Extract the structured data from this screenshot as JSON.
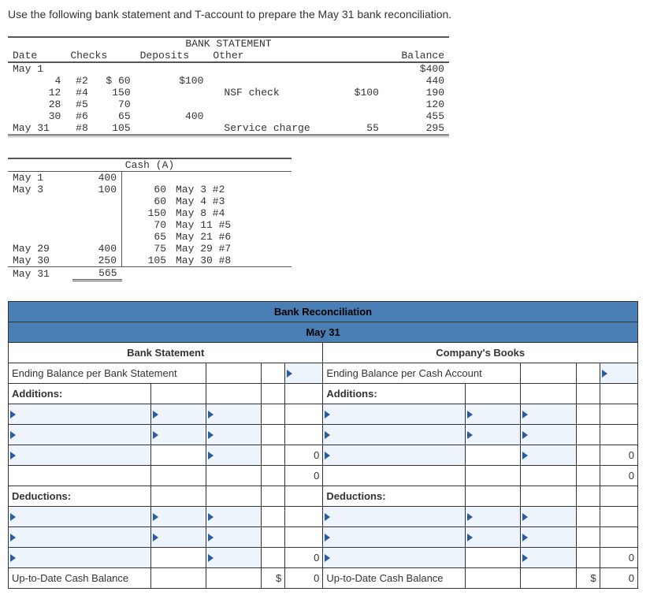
{
  "instruction": "Use the following bank statement and T-account to prepare the May 31 bank reconciliation.",
  "bank_statement": {
    "title": "BANK STATEMENT",
    "headers": {
      "date": "Date",
      "checks": "Checks",
      "deposits": "Deposits",
      "other": "Other",
      "balance": "Balance"
    },
    "rows": [
      {
        "date": "May 1",
        "check_no": "",
        "check_amt": "",
        "deposit": "",
        "other": "",
        "other_amt": "",
        "balance": "$400"
      },
      {
        "date": "4",
        "check_no": "#2",
        "check_amt": "$ 60",
        "deposit": "$100",
        "other": "",
        "other_amt": "",
        "balance": "440"
      },
      {
        "date": "12",
        "check_no": "#4",
        "check_amt": "150",
        "deposit": "",
        "other": "NSF check",
        "other_amt": "$100",
        "balance": "190"
      },
      {
        "date": "28",
        "check_no": "#5",
        "check_amt": "70",
        "deposit": "",
        "other": "",
        "other_amt": "",
        "balance": "120"
      },
      {
        "date": "30",
        "check_no": "#6",
        "check_amt": "65",
        "deposit": "400",
        "other": "",
        "other_amt": "",
        "balance": "455"
      },
      {
        "date": "May 31",
        "check_no": "#8",
        "check_amt": "105",
        "deposit": "",
        "other": "Service charge",
        "other_amt": "55",
        "balance": "295"
      }
    ]
  },
  "t_account": {
    "title": "Cash (A)",
    "debits": [
      {
        "date": "May 1",
        "amt": "400"
      },
      {
        "date": "May 3",
        "amt": "100"
      },
      {
        "date": "",
        "amt": ""
      },
      {
        "date": "",
        "amt": ""
      },
      {
        "date": "",
        "amt": ""
      },
      {
        "date": "",
        "amt": ""
      },
      {
        "date": "May 29",
        "amt": "400"
      },
      {
        "date": "May 30",
        "amt": "250"
      }
    ],
    "credits": [
      {
        "amt": "",
        "desc": ""
      },
      {
        "amt": "60",
        "desc": "May 3 #2"
      },
      {
        "amt": "60",
        "desc": "May 4 #3"
      },
      {
        "amt": "150",
        "desc": "May 8 #4"
      },
      {
        "amt": "70",
        "desc": "May 11 #5"
      },
      {
        "amt": "65",
        "desc": "May 21 #6"
      },
      {
        "amt": "75",
        "desc": "May 29 #7"
      },
      {
        "amt": "105",
        "desc": "May 30 #8"
      }
    ],
    "total": {
      "date": "May 31",
      "amt": "565"
    }
  },
  "recon": {
    "title": "Bank Reconciliation",
    "subtitle": "May 31",
    "bank_side": {
      "heading": "Bank Statement",
      "end_bal_label": "Ending Balance per Bank Statement",
      "additions_label": "Additions:",
      "deductions_label": "Deductions:",
      "up_to_date_label": "Up-to-Date Cash Balance",
      "add_subtotal1": "0",
      "add_subtotal2": "0",
      "ded_subtotal": "0",
      "final_sym": "$",
      "final_val": "0"
    },
    "book_side": {
      "heading": "Company's Books",
      "end_bal_label": "Ending Balance per Cash Account",
      "additions_label": "Additions:",
      "deductions_label": "Deductions:",
      "up_to_date_label": "Up-to-Date Cash Balance",
      "add_subtotal1": "0",
      "add_subtotal2": "0",
      "ded_subtotal": "0",
      "final_sym": "$",
      "final_val": "0"
    }
  }
}
